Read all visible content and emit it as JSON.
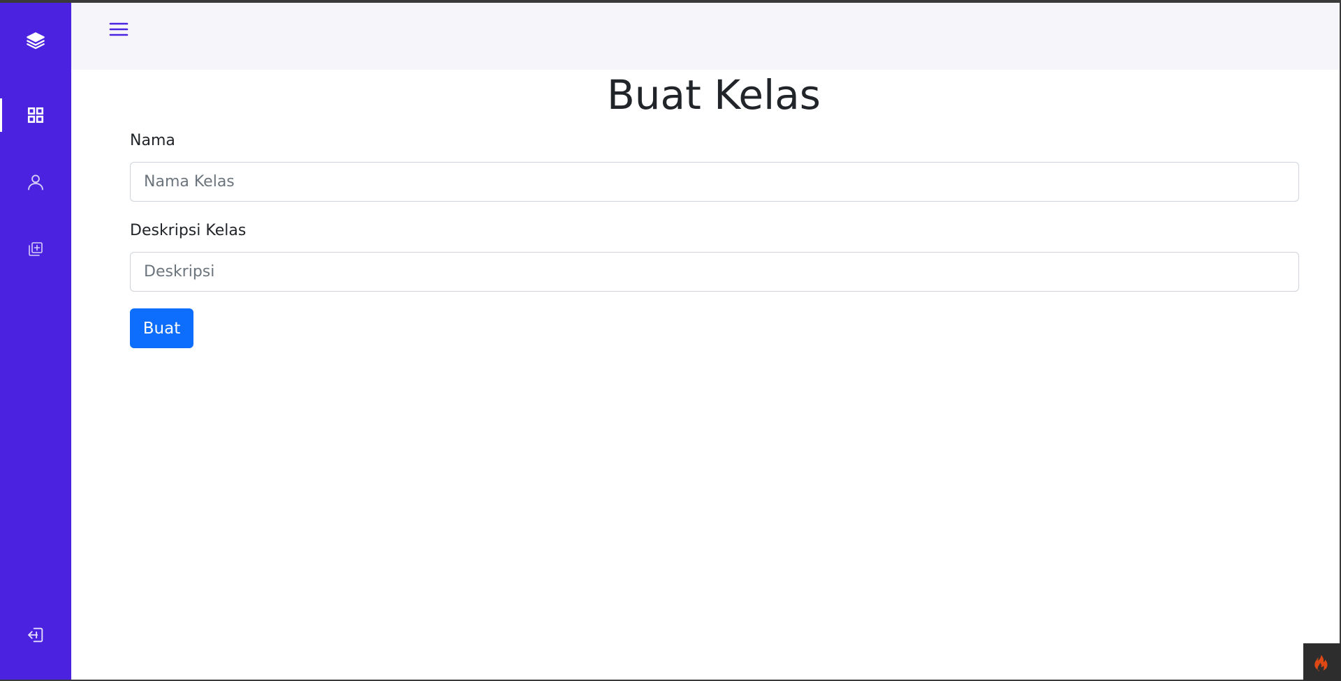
{
  "sidebar": {
    "items": [
      {
        "name": "logo-layers-icon",
        "label": "layers"
      },
      {
        "name": "dashboard-grid-icon",
        "label": "dashboard"
      },
      {
        "name": "user-icon",
        "label": "user"
      },
      {
        "name": "add-class-icon",
        "label": "add class"
      },
      {
        "name": "logout-icon",
        "label": "logout"
      }
    ],
    "active_item": "dashboard-grid-icon",
    "background_color": "#4a22df"
  },
  "header": {
    "menu_icon": "hamburger-menu-icon",
    "background_color": "#f6f6fa"
  },
  "main": {
    "title": "Buat Kelas",
    "form": {
      "name_label": "Nama",
      "name_placeholder": "Nama Kelas",
      "name_value": "",
      "description_label": "Deskripsi Kelas",
      "description_placeholder": "Deskripsi",
      "description_value": "",
      "submit_label": "Buat",
      "submit_color": "#0d6efd"
    }
  },
  "debug_toolbar": {
    "icon": "codeigniter-flame-icon"
  }
}
